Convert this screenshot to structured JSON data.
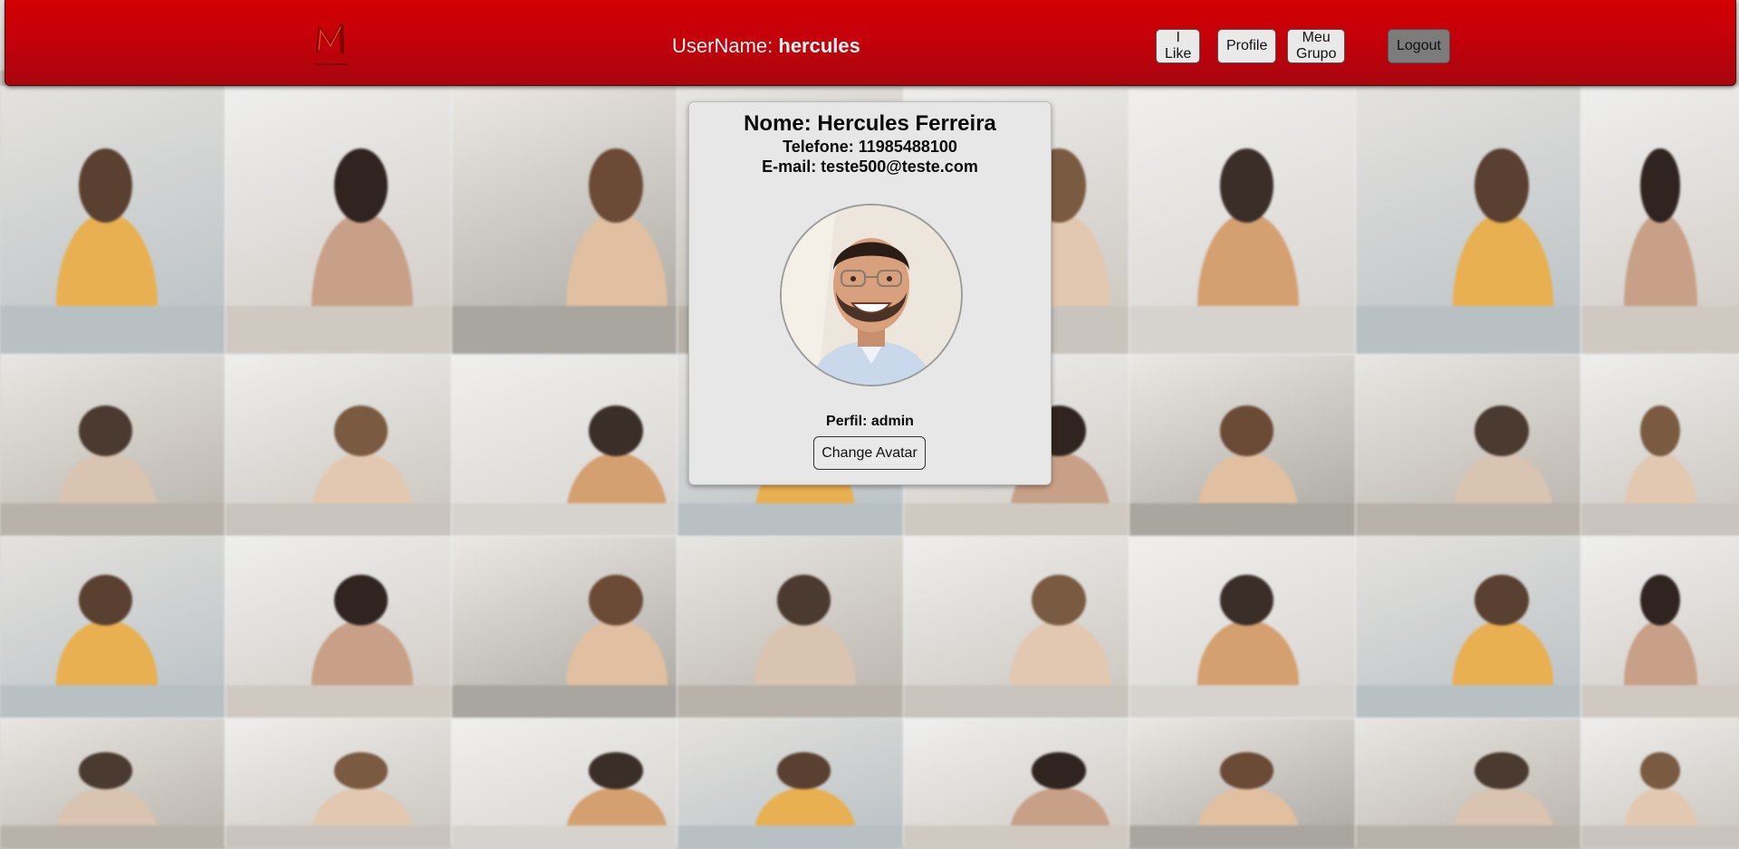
{
  "header": {
    "logo_icon": "m-brand-logo-icon",
    "username_label": "UserName:",
    "username_value": "hercules",
    "nav": [
      {
        "label": "I Like"
      },
      {
        "label": "Profile"
      },
      {
        "label": "Meu Grupo"
      },
      {
        "label": "Logout"
      }
    ]
  },
  "profile": {
    "name": "Nome: Hercules Ferreira",
    "phone": "Telefone: 11985488100",
    "email": "E-mail: teste500@teste.com",
    "perfil": "Perfil: admin",
    "change_avatar_label": "Change Avatar"
  },
  "colors": {
    "header_red": "#c4000a",
    "card_bg": "#e7e7e7",
    "logout_bg": "#7c7c7c"
  }
}
